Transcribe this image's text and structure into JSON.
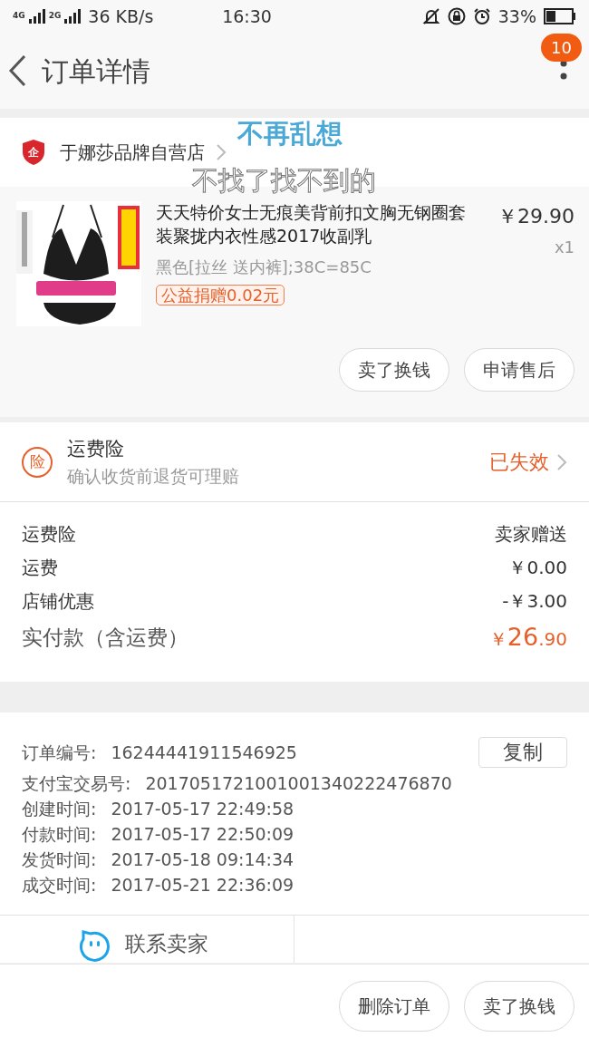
{
  "status_bar": {
    "network_1": "4G",
    "network_2": "2G",
    "speed": "36 KB/s",
    "time": "16:30",
    "battery": "33%"
  },
  "header": {
    "title": "订单详情",
    "badge": "10"
  },
  "overlay_captions": [
    "不再乱想",
    "不找了找不到的"
  ],
  "shop": {
    "name": "于娜莎品牌自营店",
    "badge": "企"
  },
  "product": {
    "title": "天天特价女士无痕美背前扣文胸无钢圈套装聚拢内衣性感2017收副乳",
    "price": "￥29.90",
    "quantity": "x1",
    "variant": "黑色[拉丝 送内裤];38C=85C",
    "donation": "公益捐赠0.02元"
  },
  "item_buttons": [
    "卖了换钱",
    "申请售后"
  ],
  "insurance": {
    "badge": "险",
    "title": "运费险",
    "subtitle": "确认收货前退货可理赔",
    "status": "已失效"
  },
  "fees": [
    {
      "label": "运费险",
      "value": "卖家赠送",
      "kind": "plain"
    },
    {
      "label": "运费",
      "value": "￥0.00",
      "kind": "plain"
    },
    {
      "label": "店铺优惠",
      "value": "-￥3.00",
      "kind": "plain"
    },
    {
      "label": "实付款（含运费）",
      "currency": "￥",
      "value": "26",
      "decimals": ".90",
      "kind": "total"
    }
  ],
  "order_info": [
    {
      "label": "订单编号:",
      "value": "16244441911546925"
    },
    {
      "label": "支付宝交易号:",
      "value": "2017051721001001340222476870"
    },
    {
      "label": "创建时间:",
      "value": "2017-05-17 22:49:58"
    },
    {
      "label": "付款时间:",
      "value": "2017-05-17 22:50:09"
    },
    {
      "label": "发货时间:",
      "value": "2017-05-18 09:14:34"
    },
    {
      "label": "成交时间:",
      "value": "2017-05-21 22:36:09"
    }
  ],
  "copy_button": "复制",
  "contact": "联系卖家",
  "bottom_buttons": [
    "删除订单",
    "卖了换钱"
  ]
}
